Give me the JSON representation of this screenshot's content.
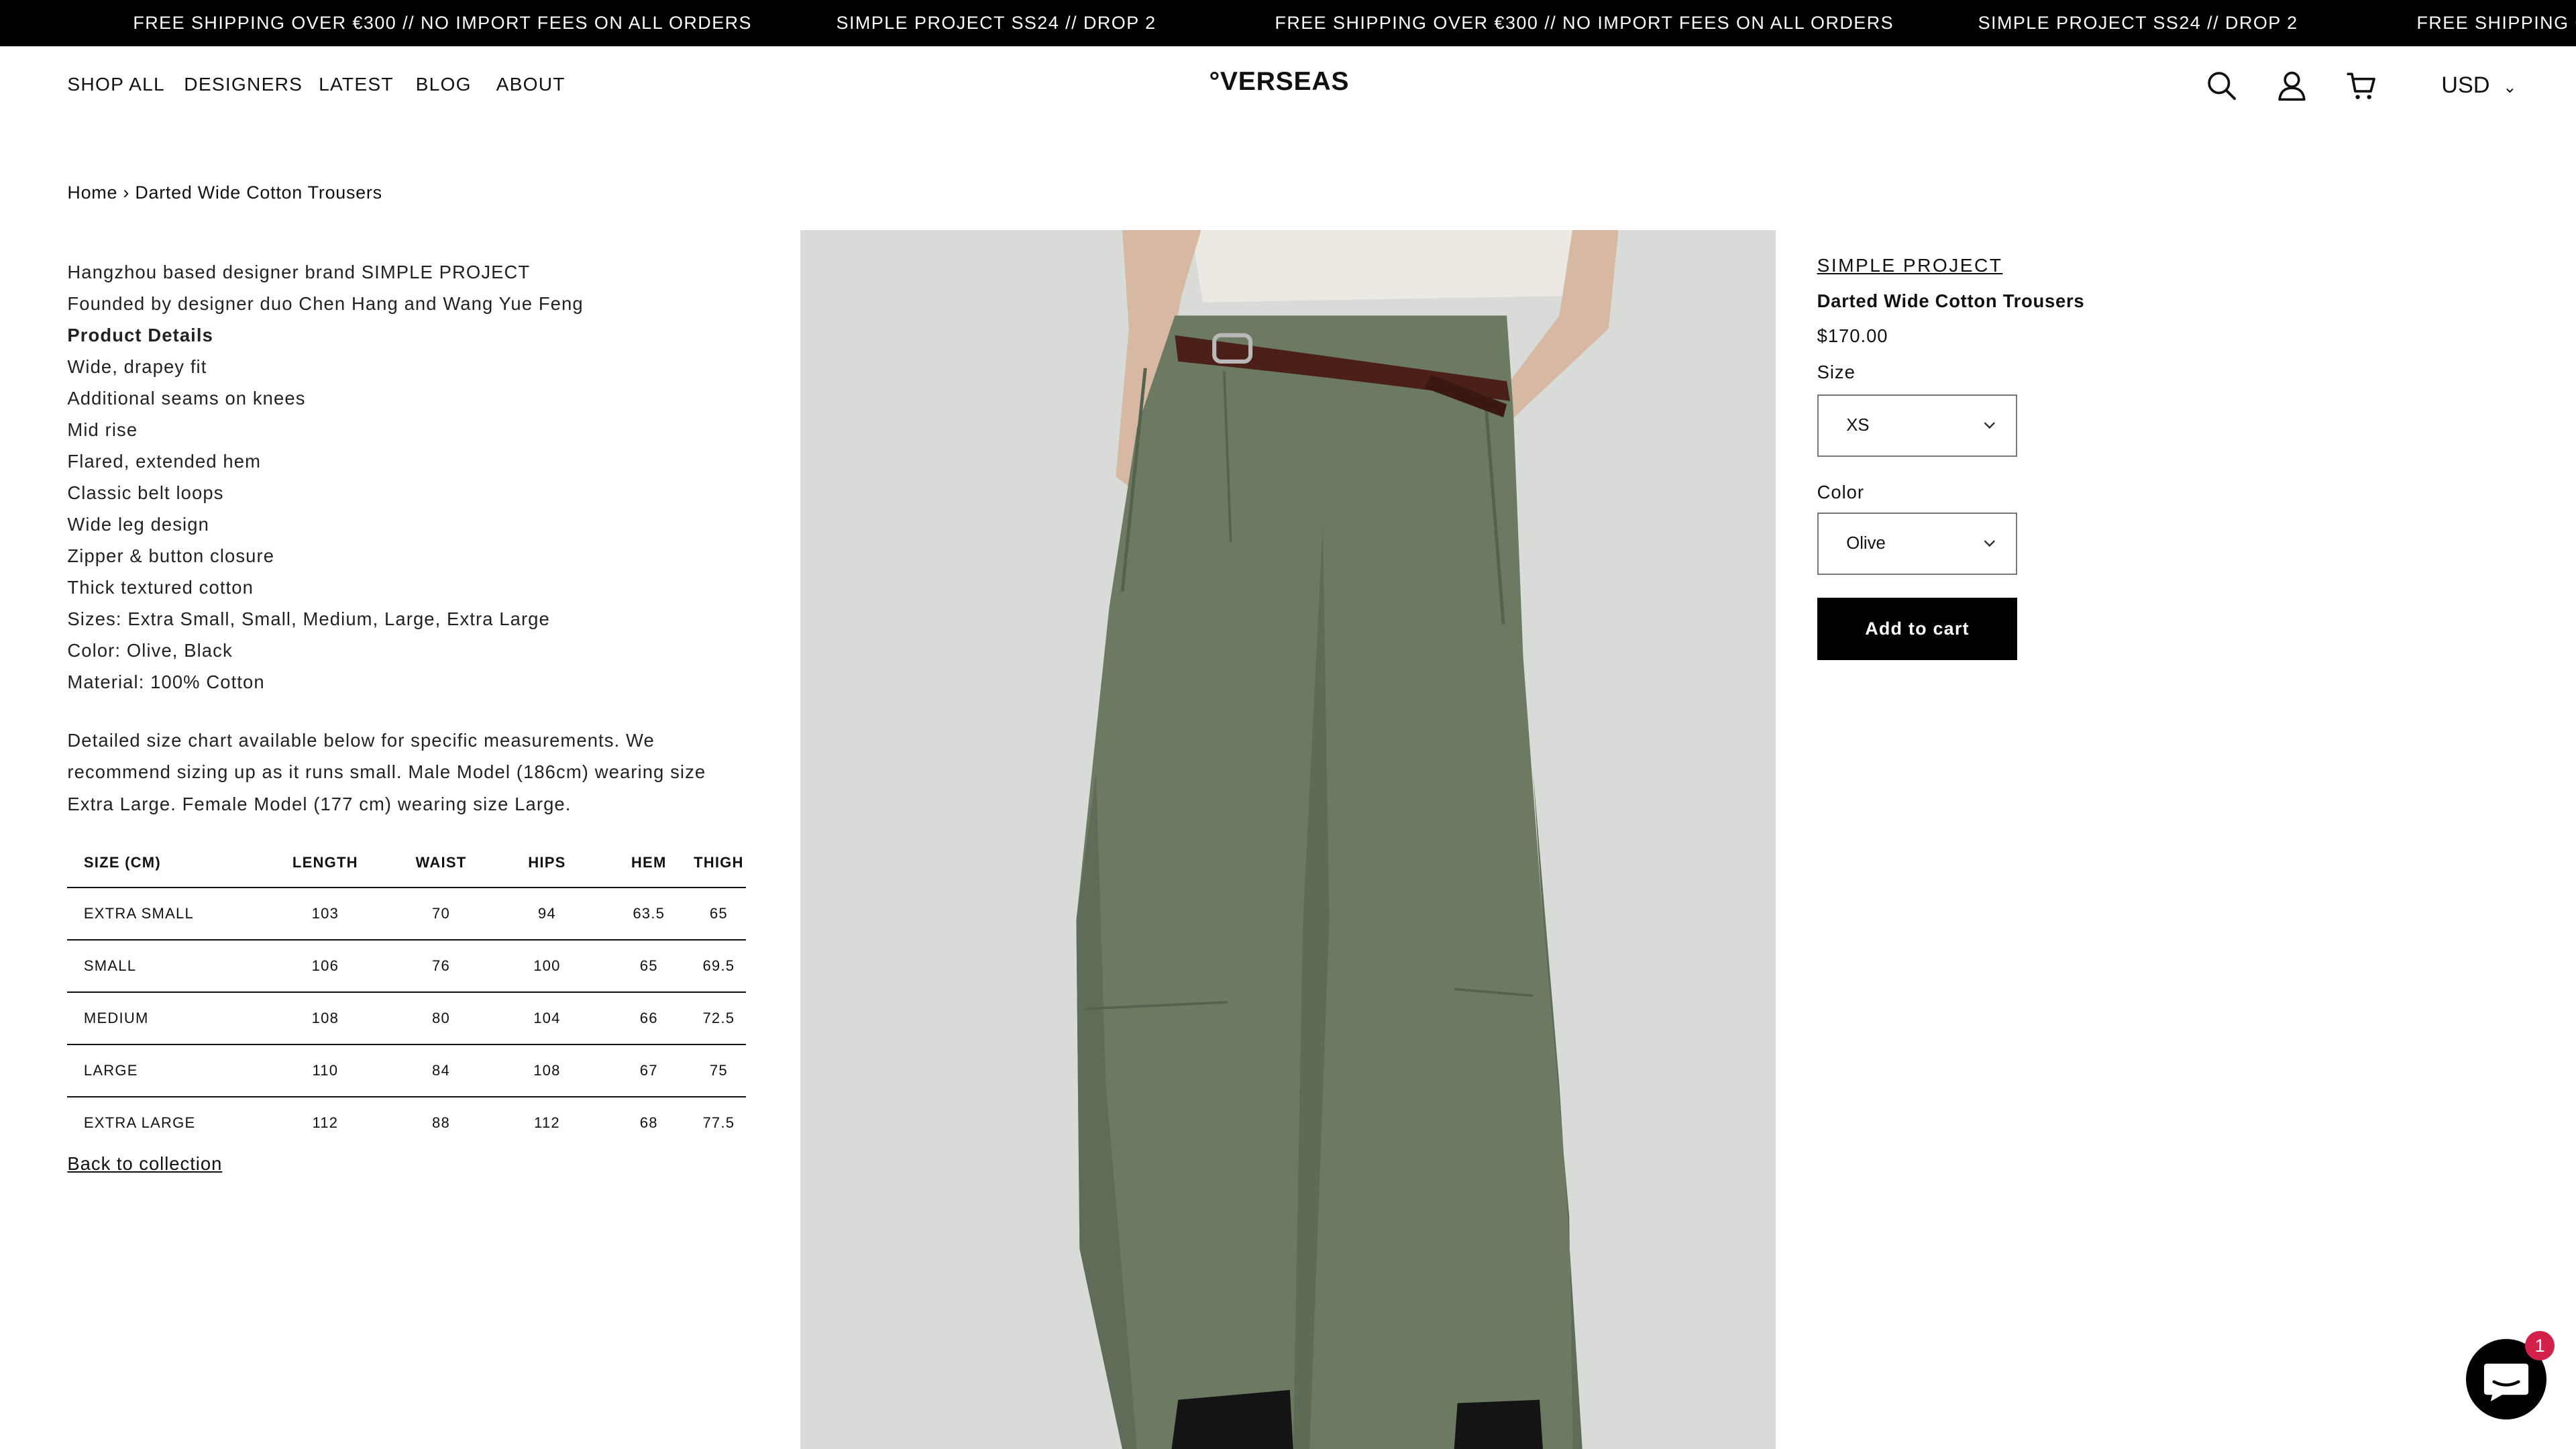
{
  "announcement": {
    "items": [
      "FREE SHIPPING OVER €300 // NO IMPORT FEES ON ALL ORDERS",
      "SIMPLE PROJECT SS24 // DROP 2",
      "FREE SHIPPING OVER €300 // NO IMPORT FEES ON ALL ORDERS",
      "SIMPLE PROJECT SS24 // DROP 2",
      "FREE SHIPPING OV"
    ]
  },
  "header": {
    "nav": [
      "SHOP ALL",
      "DESIGNERS",
      "LATEST",
      "BLOG",
      "ABOUT"
    ],
    "logo": "°VERSEAS",
    "icons": [
      "search-icon",
      "account-icon",
      "cart-icon"
    ],
    "currency": "USD"
  },
  "breadcrumb": {
    "home": "Home",
    "separator": "›",
    "current": "Darted Wide Cotton Trousers"
  },
  "description": {
    "lines": [
      "Hangzhou based designer brand SIMPLE PROJECT",
      "Founded by designer duo Chen Hang and Wang Yue Feng",
      "Product Details",
      "Wide, drapey fit",
      "Additional seams on knees",
      "Mid rise",
      "Flared, extended hem",
      "Classic belt loops",
      "Wide leg design",
      "Zipper & button closure",
      "Thick textured cotton",
      "Sizes: Extra Small, Small, Medium, Large, Extra Large",
      "Color: Olive, Black",
      "Material: 100% Cotton"
    ],
    "paragraph": "Detailed size chart available below for specific measurements. We recommend sizing up as it runs small. Male Model (186cm) wearing size Extra Large. Female Model (177 cm) wearing size Large."
  },
  "size_table": {
    "headers": [
      "SIZE (CM)",
      "LENGTH",
      "WAIST",
      "HIPS",
      "HEM",
      "THIGH"
    ],
    "rows": [
      [
        "EXTRA SMALL",
        "103",
        "70",
        "94",
        "63.5",
        "65"
      ],
      [
        "SMALL",
        "106",
        "76",
        "100",
        "65",
        "69.5"
      ],
      [
        "MEDIUM",
        "108",
        "80",
        "104",
        "66",
        "72.5"
      ],
      [
        "LARGE",
        "110",
        "84",
        "108",
        "67",
        "75"
      ],
      [
        "EXTRA LARGE",
        "112",
        "88",
        "112",
        "68",
        "77.5"
      ]
    ]
  },
  "back_link": "Back to collection",
  "product": {
    "brand": "SIMPLE PROJECT",
    "name": "Darted Wide Cotton Trousers",
    "price": "$170.00",
    "size_label": "Size",
    "size_value": "XS",
    "color_label": "Color",
    "color_value": "Olive",
    "add_to_cart": "Add to cart"
  },
  "chat": {
    "badge_count": "1"
  },
  "colors": {
    "announcement_bg": "#000000",
    "button_bg": "#000000",
    "trouser_olive": "#6c7a62",
    "photo_bg": "#d9dbd8",
    "badge": "#d1214b"
  }
}
